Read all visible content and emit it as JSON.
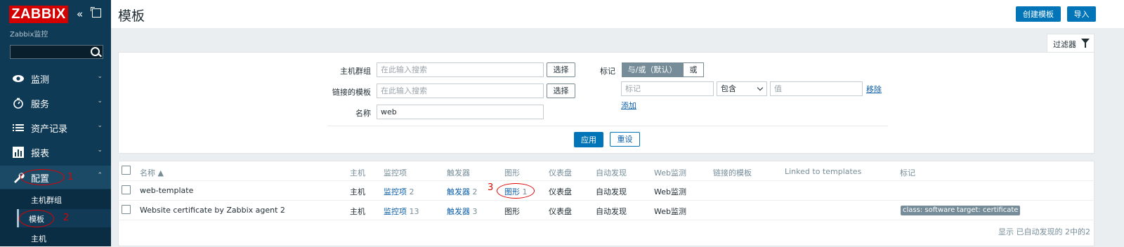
{
  "sidebar": {
    "logo": "ZABBIX",
    "collapse_icon": "«",
    "server_name": "Zabbix监控",
    "search": {
      "value": "",
      "placeholder": ""
    },
    "menu": [
      {
        "label": "监测",
        "icon": "eye-icon"
      },
      {
        "label": "服务",
        "icon": "clock-icon"
      },
      {
        "label": "资产记录",
        "icon": "list-icon"
      },
      {
        "label": "报表",
        "icon": "bar-chart-icon"
      },
      {
        "label": "配置",
        "icon": "wrench-icon"
      }
    ],
    "submenu": [
      {
        "label": "主机群组"
      },
      {
        "label": "模板"
      },
      {
        "label": "主机"
      }
    ],
    "chevron_down": "⌄",
    "chevron_up": "⌃"
  },
  "header": {
    "title": "模板",
    "create_button": "创建模板",
    "import_button": "导入"
  },
  "filter": {
    "tab_label": "过滤器",
    "host_groups": {
      "label": "主机群组",
      "placeholder": "在此输入搜索",
      "select": "选择"
    },
    "linked_templates": {
      "label": "链接的模板",
      "placeholder": "在此输入搜索",
      "select": "选择"
    },
    "name": {
      "label": "名称",
      "value": "web"
    },
    "tags": {
      "label": "标记",
      "and_or": "与/或（默认）",
      "or": "或",
      "tag_placeholder": "标记",
      "operator": "包含",
      "value_placeholder": "值",
      "remove": "移除",
      "add": "添加"
    },
    "apply": "应用",
    "reset": "重设"
  },
  "table": {
    "columns": [
      "名称 ▲",
      "主机",
      "监控项",
      "触发器",
      "图形",
      "仪表盘",
      "自动发现",
      "Web监测",
      "链接的模板",
      "Linked to templates",
      "标记"
    ],
    "rows": [
      {
        "name": "web-template",
        "hosts": "主机",
        "items": "监控项",
        "items_count": "2",
        "triggers": "触发器",
        "triggers_count": "2",
        "graphs": "图形",
        "graphs_count": "1",
        "dashboards": "仪表盘",
        "discovery": "自动发现",
        "web": "Web监测",
        "tags": []
      },
      {
        "name": "Website certificate by Zabbix agent 2",
        "hosts": "主机",
        "items": "监控项",
        "items_count": "13",
        "triggers": "触发器",
        "triggers_count": "3",
        "graphs": "图形",
        "graphs_count": "",
        "dashboards": "仪表盘",
        "discovery": "自动发现",
        "web": "Web监测",
        "tags": [
          "class: software",
          "target: certificate"
        ]
      }
    ],
    "footer": "显示 已自动发现的 2中的2"
  },
  "annotations": [
    "1",
    "2",
    "3"
  ],
  "colors": {
    "sidebar_bg": "#0e3a55",
    "logo_red": "#d40000",
    "accent_blue": "#0275b8",
    "link_blue": "#0b5ea9",
    "annotation_red": "#e00000",
    "tag_gray": "#768d99"
  }
}
